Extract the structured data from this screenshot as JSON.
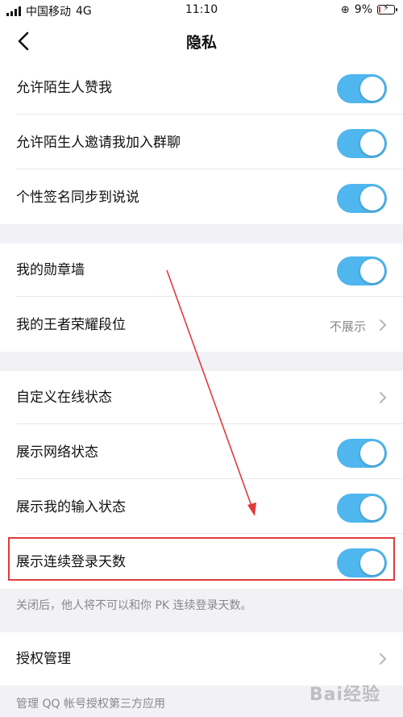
{
  "status_bar": {
    "carrier": "中国移动",
    "network": "4G",
    "time": "11:10",
    "battery_percent": "9%",
    "battery_level": 0.09
  },
  "nav": {
    "title": "隐私",
    "back_icon": "chevron-left-icon"
  },
  "groups": [
    {
      "rows": [
        {
          "label": "允许陌生人赞我",
          "control": "toggle",
          "on": true
        },
        {
          "label": "允许陌生人邀请我加入群聊",
          "control": "toggle",
          "on": true
        },
        {
          "label": "个性签名同步到说说",
          "control": "toggle",
          "on": true
        }
      ]
    },
    {
      "rows": [
        {
          "label": "我的勋章墙",
          "control": "toggle",
          "on": true
        },
        {
          "label": "我的王者荣耀段位",
          "control": "value",
          "value": "不展示"
        }
      ]
    },
    {
      "rows": [
        {
          "label": "自定义在线状态",
          "control": "chevron"
        },
        {
          "label": "展示网络状态",
          "control": "toggle",
          "on": true
        },
        {
          "label": "展示我的输入状态",
          "control": "toggle",
          "on": true
        },
        {
          "label": "展示连续登录天数",
          "control": "toggle",
          "on": true
        }
      ],
      "footnote": "关闭后，他人将不可以和你 PK 连续登录天数。"
    },
    {
      "rows": [
        {
          "label": "授权管理",
          "control": "chevron"
        }
      ],
      "footnote": "管理 QQ 帐号授权第三方应用"
    }
  ],
  "colors": {
    "toggle_on": "#4fb6ee",
    "annotation": "#e03b3b",
    "background": "#f2f2f6"
  },
  "watermark": "Bai经验"
}
